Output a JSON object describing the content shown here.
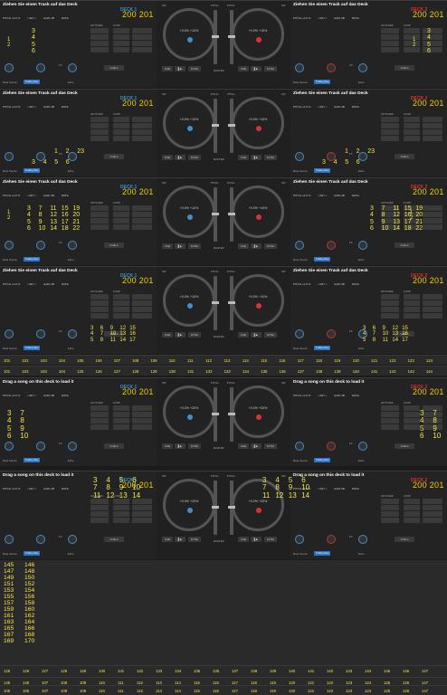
{
  "deck_strings": {
    "title_de": "Ziehen Sie einen Track auf das Deck",
    "title_en": "Drag a song on this deck to load it",
    "deck1": "DECK 1",
    "deck2": "DECK 2",
    "bpm": "200 201",
    "pitch": "PITCH +0.0 %",
    "key": "• KEY •",
    "gain": "GAIN  dB",
    "rate": "RATE",
    "jog_left": "+0.0%  +10%",
    "jog_right": "+0.0%  +10%",
    "jog_left20": "+0.0%  +20%",
    "cue": "CUE",
    "play": "▌▶",
    "sync": "SYNC",
    "loop": "LOOP",
    "hotcues": "HOTCUES",
    "pitch_label": "PITCH",
    "sip": "S/P",
    "master": "MASTER",
    "fx": "FX",
    "echo": "Echo",
    "mute_source": "Mute Source",
    "trailing_stop": "Trailing Stop",
    "cue_a": "CUE A",
    "beatjump": "BEATJUMP",
    "slide": "Slide A",
    "page1": "Page 1",
    "load": "LOAD",
    "mute_trailing": "Mute So...  Trailing S..."
  },
  "panel1": {
    "left": [
      "3",
      "4",
      "5",
      "6"
    ],
    "left_small": [
      "1",
      "2"
    ],
    "right": [
      "3",
      "4",
      "5",
      "6"
    ],
    "right_small": [
      "1",
      "2"
    ]
  },
  "panel2": {
    "bottom_left": [
      "3",
      "4",
      "5",
      "6"
    ],
    "bottom_right": [
      "3",
      "4",
      "5",
      "6"
    ],
    "top_left": [
      "1",
      "2",
      "23"
    ],
    "top_right": [
      "1",
      "2",
      "23"
    ]
  },
  "panel3": {
    "left": [
      [
        "3",
        "7",
        "11",
        "15",
        "19"
      ],
      [
        "4",
        "8",
        "12",
        "16",
        "20"
      ],
      [
        "5",
        "9",
        "13",
        "17",
        "21"
      ],
      [
        "6",
        "10",
        "14",
        "18",
        "22"
      ]
    ],
    "small": [
      "1",
      "2"
    ]
  },
  "panel4": {
    "left": [
      [
        "3",
        "6",
        "9",
        "12",
        "15"
      ],
      [
        "4",
        "7",
        "10",
        "13",
        "16"
      ],
      [
        "5",
        "8",
        "11",
        "14",
        "17"
      ]
    ],
    "left_extra": [
      "18",
      "19"
    ],
    "right": [
      [
        "3",
        "6",
        "9",
        "12",
        "15"
      ],
      [
        "4",
        "7",
        "10",
        "13",
        "16"
      ],
      [
        "5",
        "8",
        "11",
        "14",
        "17"
      ]
    ],
    "right_extra": [
      "18",
      "19"
    ],
    "small": [
      "1",
      "2"
    ]
  },
  "row1": [
    "101",
    "102",
    "103",
    "104",
    "105",
    "106",
    "107",
    "108",
    "109",
    "110",
    "111",
    "112",
    "113",
    "114",
    "115",
    "116",
    "117",
    "118",
    "119",
    "120",
    "121",
    "122",
    "123",
    "124"
  ],
  "row2": [
    "101",
    "102",
    "103",
    "104",
    "125",
    "126",
    "127",
    "128",
    "129",
    "130",
    "131",
    "132",
    "133",
    "134",
    "135",
    "136",
    "137",
    "138",
    "139",
    "140",
    "141",
    "142",
    "143",
    "144"
  ],
  "panel5": {
    "left": [
      [
        "3",
        "7"
      ],
      [
        "4",
        "8"
      ],
      [
        "5",
        "9"
      ],
      [
        "6",
        "10"
      ]
    ],
    "right": [
      [
        "3",
        "7"
      ],
      [
        "4",
        "8"
      ],
      [
        "5",
        "9"
      ],
      [
        "6",
        "10"
      ]
    ]
  },
  "panel6": {
    "grid": [
      [
        "3",
        "4",
        "5",
        "6"
      ],
      [
        "7",
        "8",
        "9",
        "10"
      ],
      [
        "11",
        "12",
        "13",
        "14"
      ]
    ],
    "grid_right": [
      [
        "3",
        "4",
        "5",
        "6"
      ],
      [
        "7",
        "8",
        "9",
        "10"
      ],
      [
        "11",
        "12",
        "13",
        "14"
      ]
    ]
  },
  "col_a": [
    "145",
    "147",
    "149",
    "151",
    "153",
    "155",
    "157",
    "159",
    "161",
    "163",
    "165",
    "167",
    "169"
  ],
  "col_b": [
    "146",
    "148",
    "150",
    "152",
    "154",
    "156",
    "158",
    "160",
    "162",
    "164",
    "166",
    "168",
    "170"
  ],
  "row_bottom1": [
    "125",
    "126",
    "127",
    "128",
    "129",
    "130",
    "131",
    "132",
    "133",
    "134",
    "135",
    "136",
    "137",
    "138",
    "139",
    "140",
    "141",
    "142",
    "143",
    "144",
    "145",
    "146",
    "147"
  ],
  "row_bottom0": [
    "145",
    "146",
    "107",
    "108",
    "109",
    "110",
    "111",
    "112",
    "113",
    "114",
    "115",
    "116",
    "117",
    "118",
    "119",
    "120",
    "121",
    "122",
    "123",
    "124",
    "125",
    "126",
    "147"
  ],
  "row_bottom2": [
    "105",
    "106",
    "107",
    "108",
    "109",
    "110",
    "111",
    "112",
    "113",
    "114",
    "115",
    "116",
    "117",
    "118",
    "119",
    "120",
    "121",
    "122",
    "123",
    "124",
    "125",
    "126",
    "147"
  ],
  "colors": {
    "accent": "#f4e64a",
    "blue": "#2a74c8",
    "red": "#c03030",
    "deck1": "#3d8fd0",
    "deck2": "#e03030"
  }
}
